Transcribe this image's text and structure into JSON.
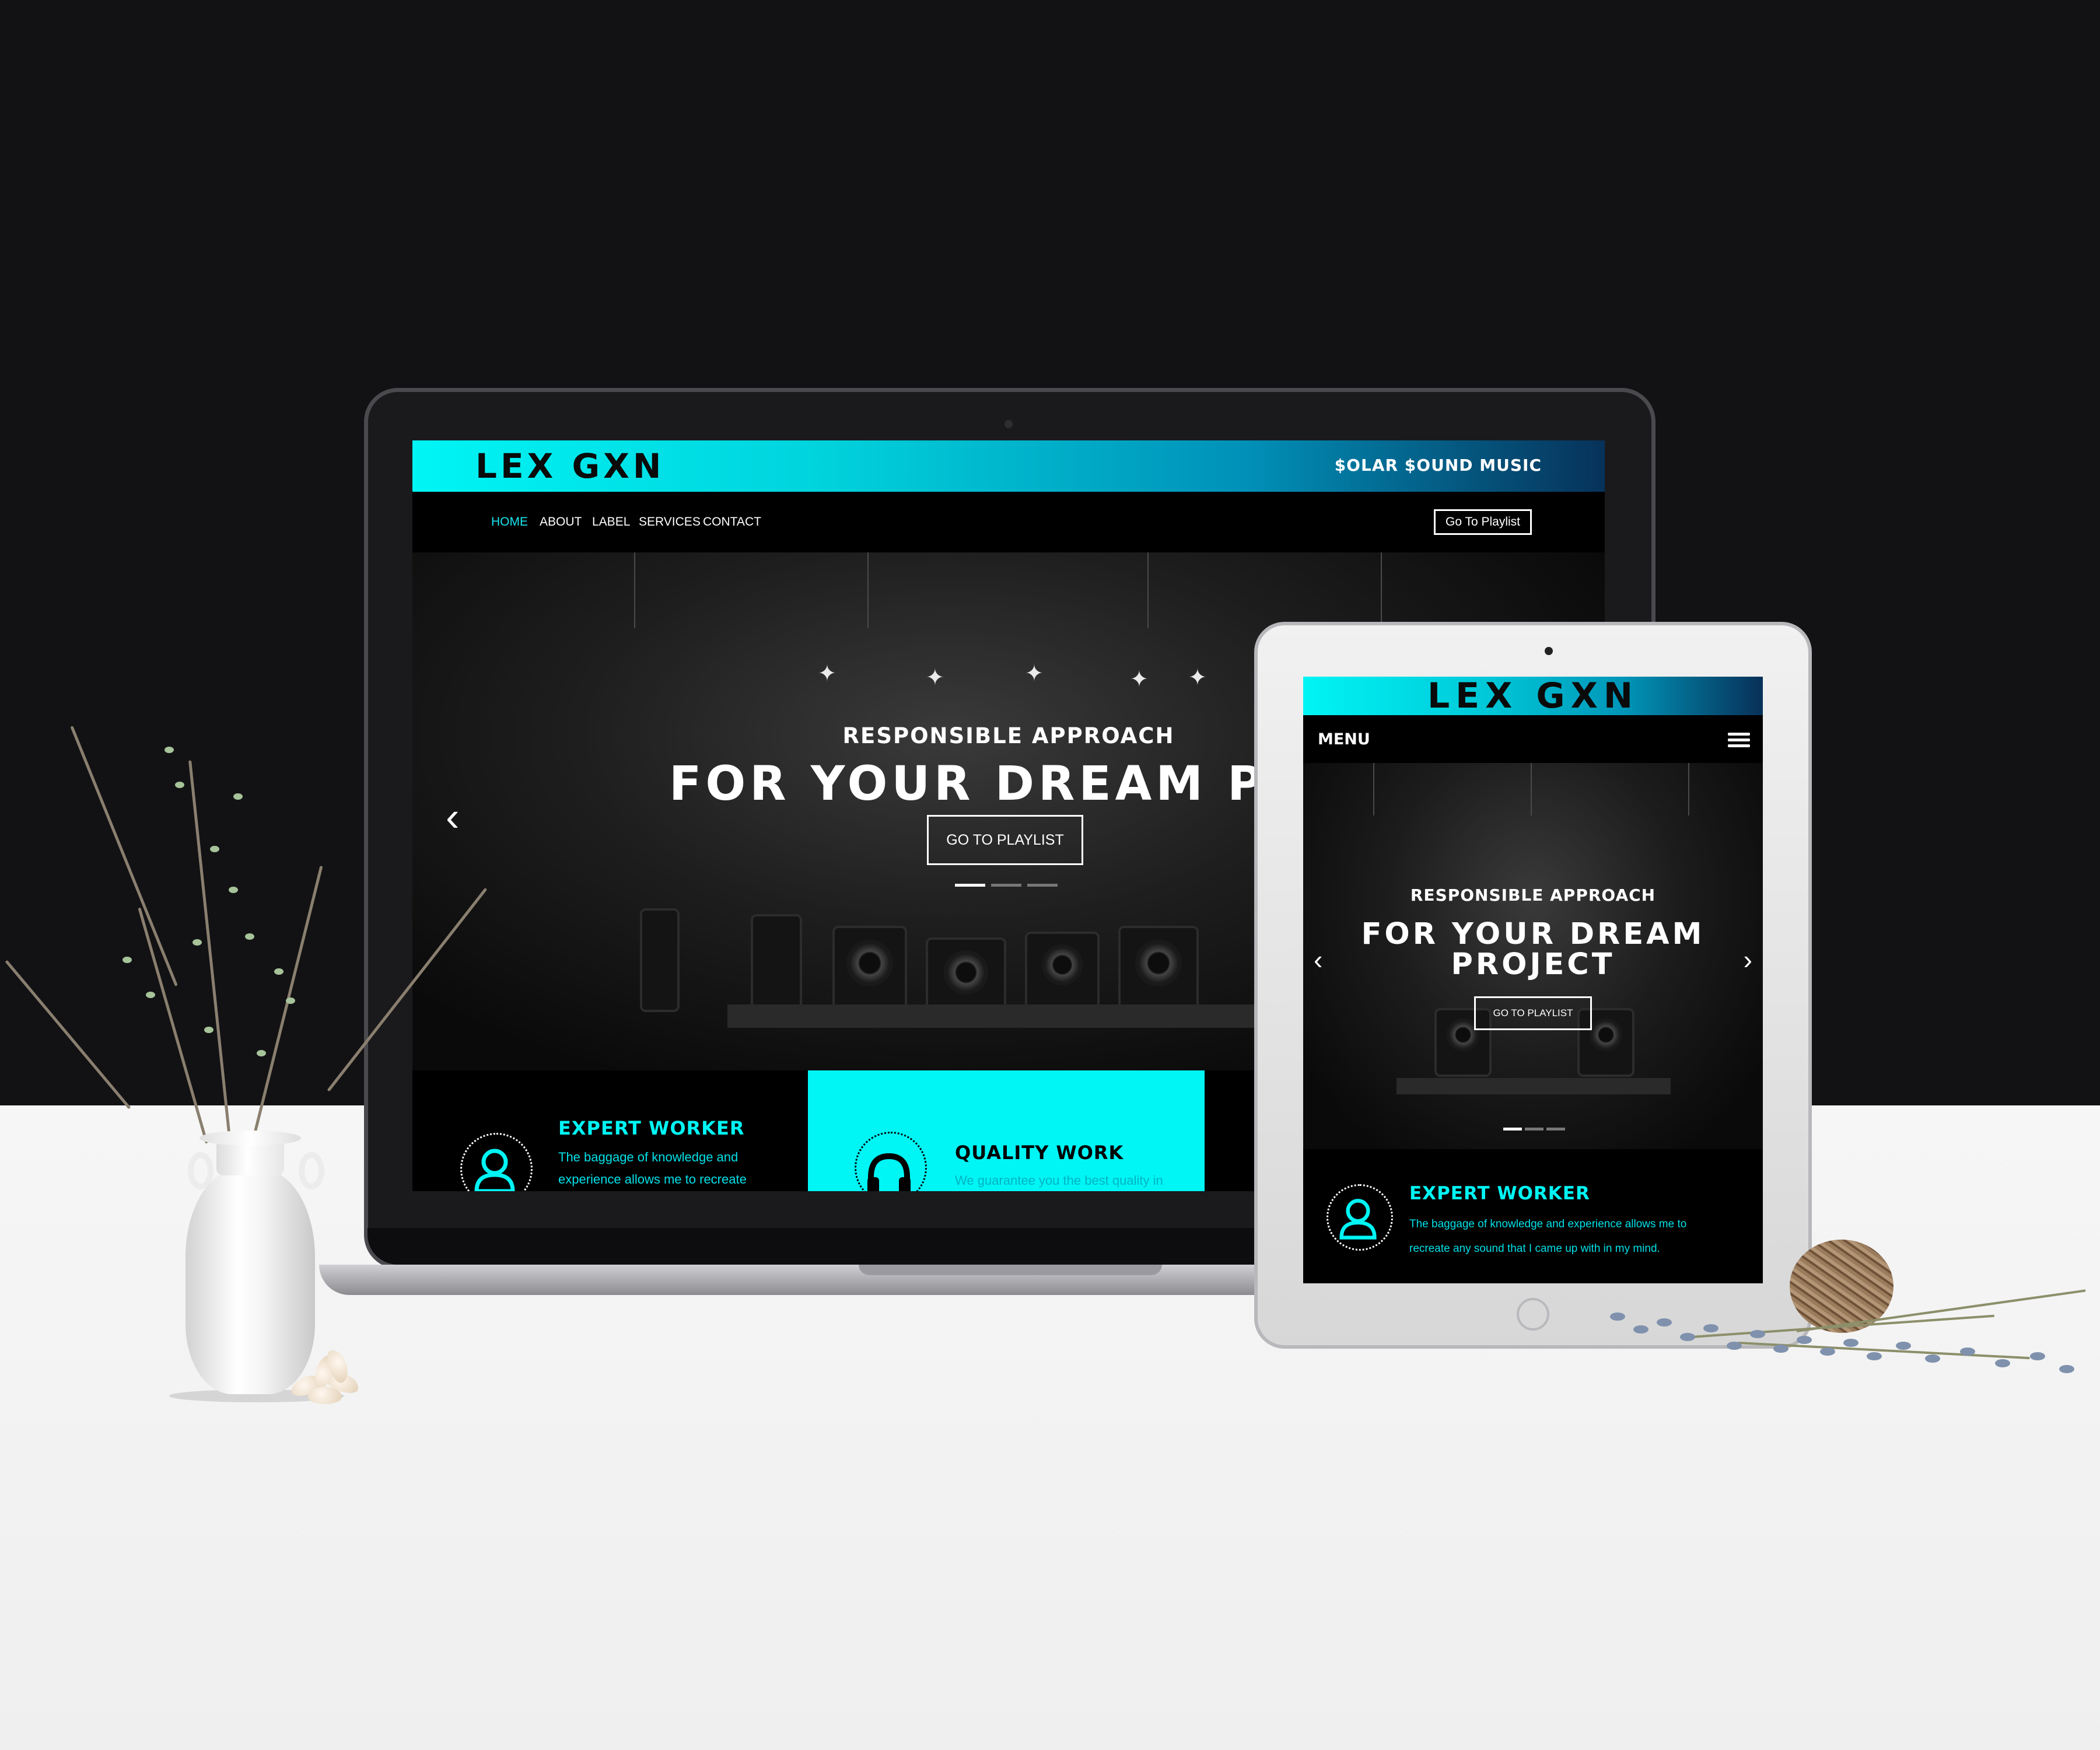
{
  "site": {
    "logo": "LEX GXN",
    "tagline": "$OLAR $OUND MUSIC",
    "accent_color": "#00f5f5",
    "background_color": "#000000"
  },
  "laptop": {
    "nav": {
      "items": [
        {
          "label": "HOME",
          "active": true
        },
        {
          "label": "ABOUT",
          "active": false
        },
        {
          "label": "LABEL",
          "active": false
        },
        {
          "label": "SERVICES",
          "active": false
        },
        {
          "label": "CONTACT",
          "active": false
        }
      ],
      "playlist_button": "Go To Playlist"
    },
    "hero": {
      "subtitle": "RESPONSIBLE APPROACH",
      "title": "FOR YOUR DREAM PROJE",
      "button": "GO TO PLAYLIST",
      "prev_arrow": "‹",
      "slide_count": 3,
      "active_slide": 1
    },
    "features": [
      {
        "title": "EXPERT WORKER",
        "text_line1": "The baggage of knowledge and",
        "text_line2": "experience allows me to recreate",
        "icon": "user-icon"
      },
      {
        "title": "QUALITY WORK",
        "text_line1": "We guarantee you the best quality in",
        "icon": "headphones-icon"
      }
    ]
  },
  "tablet": {
    "menu_label": "MENU",
    "hero": {
      "subtitle": "RESPONSIBLE APPROACH",
      "title_line1": "FOR YOUR DREAM",
      "title_line2": "PROJECT",
      "button": "GO TO PLAYLIST",
      "prev_arrow": "‹",
      "next_arrow": "›",
      "slide_count": 3,
      "active_slide": 1
    },
    "feature": {
      "title": "EXPERT WORKER",
      "text_line1": "The baggage of knowledge and experience allows me to",
      "text_line2": "recreate any sound that I came up with in my mind.",
      "icon": "user-icon"
    }
  }
}
